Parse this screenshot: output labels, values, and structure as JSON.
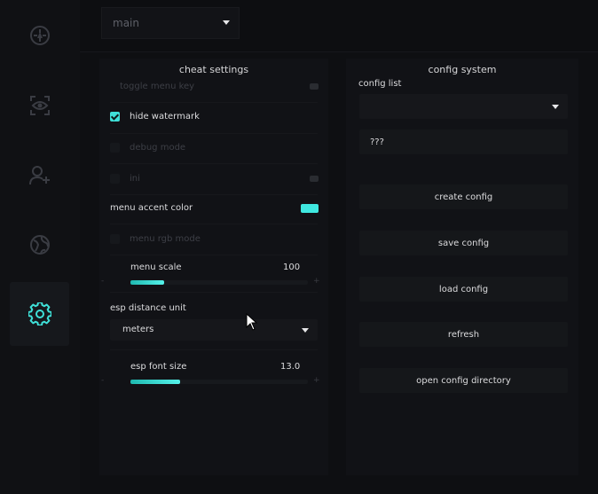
{
  "sidebar": {
    "items": [
      {
        "icon": "crosshair-icon",
        "active": false
      },
      {
        "icon": "eye-scan-icon",
        "active": false
      },
      {
        "icon": "user-add-icon",
        "active": false
      },
      {
        "icon": "globe-icon",
        "active": false
      },
      {
        "icon": "gear-icon",
        "active": true
      }
    ],
    "accent_color": "#3fe0d8",
    "inactive_icon_color": "#3a3c43"
  },
  "header": {
    "tab_select_value": "main"
  },
  "cheat_settings": {
    "title": "cheat settings",
    "toggle_menu_key": "toggle menu key",
    "hide_watermark": "hide watermark",
    "hide_watermark_checked": true,
    "debug_mode": "debug mode",
    "debug_mode_checked": false,
    "ini": "ini",
    "menu_accent_color": "menu accent color",
    "menu_accent_swatch": "#3fe8e0",
    "menu_rgb_mode": "menu rgb mode",
    "menu_rgb_mode_checked": false,
    "menu_scale_label": "menu scale",
    "menu_scale_value": "100",
    "menu_scale_fill_fraction": 0.19,
    "esp_distance_unit_label": "esp distance unit",
    "esp_distance_unit_value": "meters",
    "esp_font_size_label": "esp font size",
    "esp_font_size_value": "13.0",
    "esp_font_size_fill_fraction": 0.28,
    "slider_minus": "-",
    "slider_plus": "+"
  },
  "config_system": {
    "title": "config system",
    "config_list_label": "config list",
    "config_list_value": "",
    "config_name_value": "???",
    "buttons": {
      "create": "create config",
      "save": "save config",
      "load": "load config",
      "refresh": "refresh",
      "open_dir": "open config directory"
    }
  }
}
